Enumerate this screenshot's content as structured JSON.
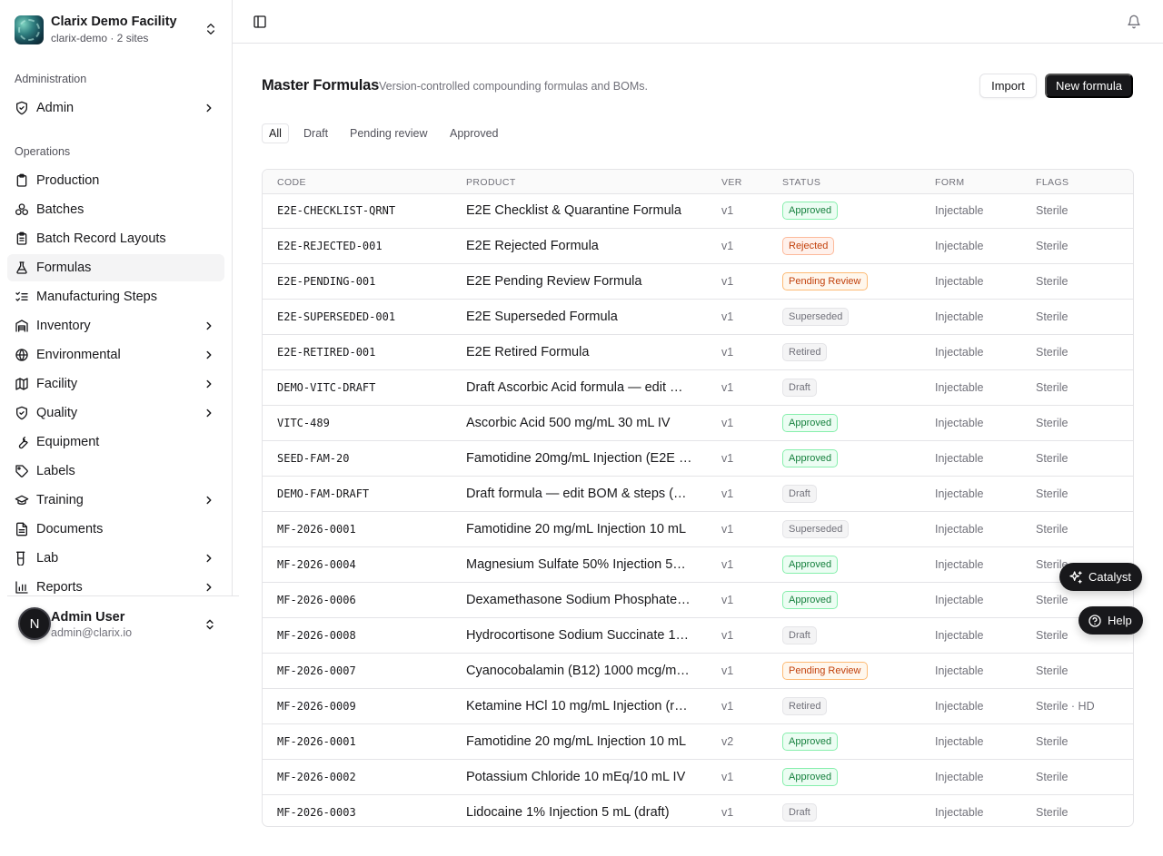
{
  "org": {
    "name": "Clarix Demo Facility",
    "subtitle": "clarix-demo · 2 sites"
  },
  "sidebar": {
    "sections": [
      {
        "label": "Administration"
      },
      {
        "label": "Operations"
      }
    ],
    "items": [
      {
        "label": "Admin",
        "icon": "shield-icon",
        "has_submenu": true
      },
      {
        "label": "Production",
        "icon": "clipboard-icon",
        "has_submenu": false
      },
      {
        "label": "Batches",
        "icon": "boxes-icon",
        "has_submenu": false
      },
      {
        "label": "Batch Record Layouts",
        "icon": "clipboard-list-icon",
        "has_submenu": false
      },
      {
        "label": "Formulas",
        "icon": "flask-icon",
        "has_submenu": false,
        "active": true
      },
      {
        "label": "Manufacturing Steps",
        "icon": "list-checks-icon",
        "has_submenu": false
      },
      {
        "label": "Inventory",
        "icon": "warehouse-icon",
        "has_submenu": true
      },
      {
        "label": "Environmental",
        "icon": "globe-icon",
        "has_submenu": true
      },
      {
        "label": "Facility",
        "icon": "map-icon",
        "has_submenu": true
      },
      {
        "label": "Quality",
        "icon": "shield-check-icon",
        "has_submenu": true
      },
      {
        "label": "Equipment",
        "icon": "wrench-icon",
        "has_submenu": false
      },
      {
        "label": "Labels",
        "icon": "tag-icon",
        "has_submenu": false
      },
      {
        "label": "Training",
        "icon": "graduation-cap-icon",
        "has_submenu": true
      },
      {
        "label": "Documents",
        "icon": "file-text-icon",
        "has_submenu": false
      },
      {
        "label": "Lab",
        "icon": "test-tube-icon",
        "has_submenu": true
      },
      {
        "label": "Reports",
        "icon": "bar-chart-icon",
        "has_submenu": true
      }
    ]
  },
  "user": {
    "initial": "N",
    "name": "Admin User",
    "email": "admin@clarix.io"
  },
  "header": {
    "title": "Master Formulas",
    "description": "Version-controlled compounding formulas and BOMs.",
    "import_label": "Import",
    "new_label": "New formula"
  },
  "tabs": [
    {
      "label": "All",
      "active": true
    },
    {
      "label": "Draft"
    },
    {
      "label": "Pending review"
    },
    {
      "label": "Approved"
    }
  ],
  "table": {
    "columns": [
      "CODE",
      "PRODUCT",
      "VER",
      "STATUS",
      "FORM",
      "FLAGS"
    ],
    "rows": [
      {
        "code": "E2E-CHECKLIST-QRNT",
        "product": "E2E Checklist & Quarantine Formula",
        "ver": "v1",
        "status": "Approved",
        "form": "Injectable",
        "flags": "Sterile"
      },
      {
        "code": "E2E-REJECTED-001",
        "product": "E2E Rejected Formula",
        "ver": "v1",
        "status": "Rejected",
        "form": "Injectable",
        "flags": "Sterile"
      },
      {
        "code": "E2E-PENDING-001",
        "product": "E2E Pending Review Formula",
        "ver": "v1",
        "status": "Pending Review",
        "form": "Injectable",
        "flags": "Sterile"
      },
      {
        "code": "E2E-SUPERSEDED-001",
        "product": "E2E Superseded Formula",
        "ver": "v1",
        "status": "Superseded",
        "form": "Injectable",
        "flags": "Sterile"
      },
      {
        "code": "E2E-RETIRED-001",
        "product": "E2E Retired Formula",
        "ver": "v1",
        "status": "Retired",
        "form": "Injectable",
        "flags": "Sterile"
      },
      {
        "code": "DEMO-VITC-DRAFT",
        "product": "Draft Ascorbic Acid formula — edit …",
        "ver": "v1",
        "status": "Draft",
        "form": "Injectable",
        "flags": "Sterile"
      },
      {
        "code": "VITC-489",
        "product": "Ascorbic Acid 500 mg/mL 30 mL IV",
        "ver": "v1",
        "status": "Approved",
        "form": "Injectable",
        "flags": "Sterile"
      },
      {
        "code": "SEED-FAM-20",
        "product": "Famotidine 20mg/mL Injection (E2E …",
        "ver": "v1",
        "status": "Approved",
        "form": "Injectable",
        "flags": "Sterile"
      },
      {
        "code": "DEMO-FAM-DRAFT",
        "product": "Draft formula — edit BOM & steps (…",
        "ver": "v1",
        "status": "Draft",
        "form": "Injectable",
        "flags": "Sterile"
      },
      {
        "code": "MF-2026-0001",
        "product": "Famotidine 20 mg/mL Injection 10 mL",
        "ver": "v1",
        "status": "Superseded",
        "form": "Injectable",
        "flags": "Sterile"
      },
      {
        "code": "MF-2026-0004",
        "product": "Magnesium Sulfate 50% Injection 5…",
        "ver": "v1",
        "status": "Approved",
        "form": "Injectable",
        "flags": "Sterile"
      },
      {
        "code": "MF-2026-0006",
        "product": "Dexamethasone Sodium Phosphate…",
        "ver": "v1",
        "status": "Approved",
        "form": "Injectable",
        "flags": "Sterile"
      },
      {
        "code": "MF-2026-0008",
        "product": "Hydrocortisone Sodium Succinate 1…",
        "ver": "v1",
        "status": "Draft",
        "form": "Injectable",
        "flags": "Sterile"
      },
      {
        "code": "MF-2026-0007",
        "product": "Cyanocobalamin (B12) 1000 mcg/m…",
        "ver": "v1",
        "status": "Pending Review",
        "form": "Injectable",
        "flags": "Sterile"
      },
      {
        "code": "MF-2026-0009",
        "product": "Ketamine HCl 10 mg/mL Injection (r…",
        "ver": "v1",
        "status": "Retired",
        "form": "Injectable",
        "flags": "Sterile · HD"
      },
      {
        "code": "MF-2026-0001",
        "product": "Famotidine 20 mg/mL Injection 10 mL",
        "ver": "v2",
        "status": "Approved",
        "form": "Injectable",
        "flags": "Sterile"
      },
      {
        "code": "MF-2026-0002",
        "product": "Potassium Chloride 10 mEq/10 mL IV",
        "ver": "v1",
        "status": "Approved",
        "form": "Injectable",
        "flags": "Sterile"
      },
      {
        "code": "MF-2026-0003",
        "product": "Lidocaine 1% Injection 5 mL (draft)",
        "ver": "v1",
        "status": "Draft",
        "form": "Injectable",
        "flags": "Sterile"
      }
    ]
  },
  "floating": {
    "catalyst_label": "Catalyst",
    "help_label": "Help"
  },
  "colors": {
    "primary": "#18181b",
    "approved": "#15803d",
    "rejected": "#c2410c",
    "pending": "#c2410c",
    "muted": "#71717a",
    "border": "#e4e4e7"
  }
}
